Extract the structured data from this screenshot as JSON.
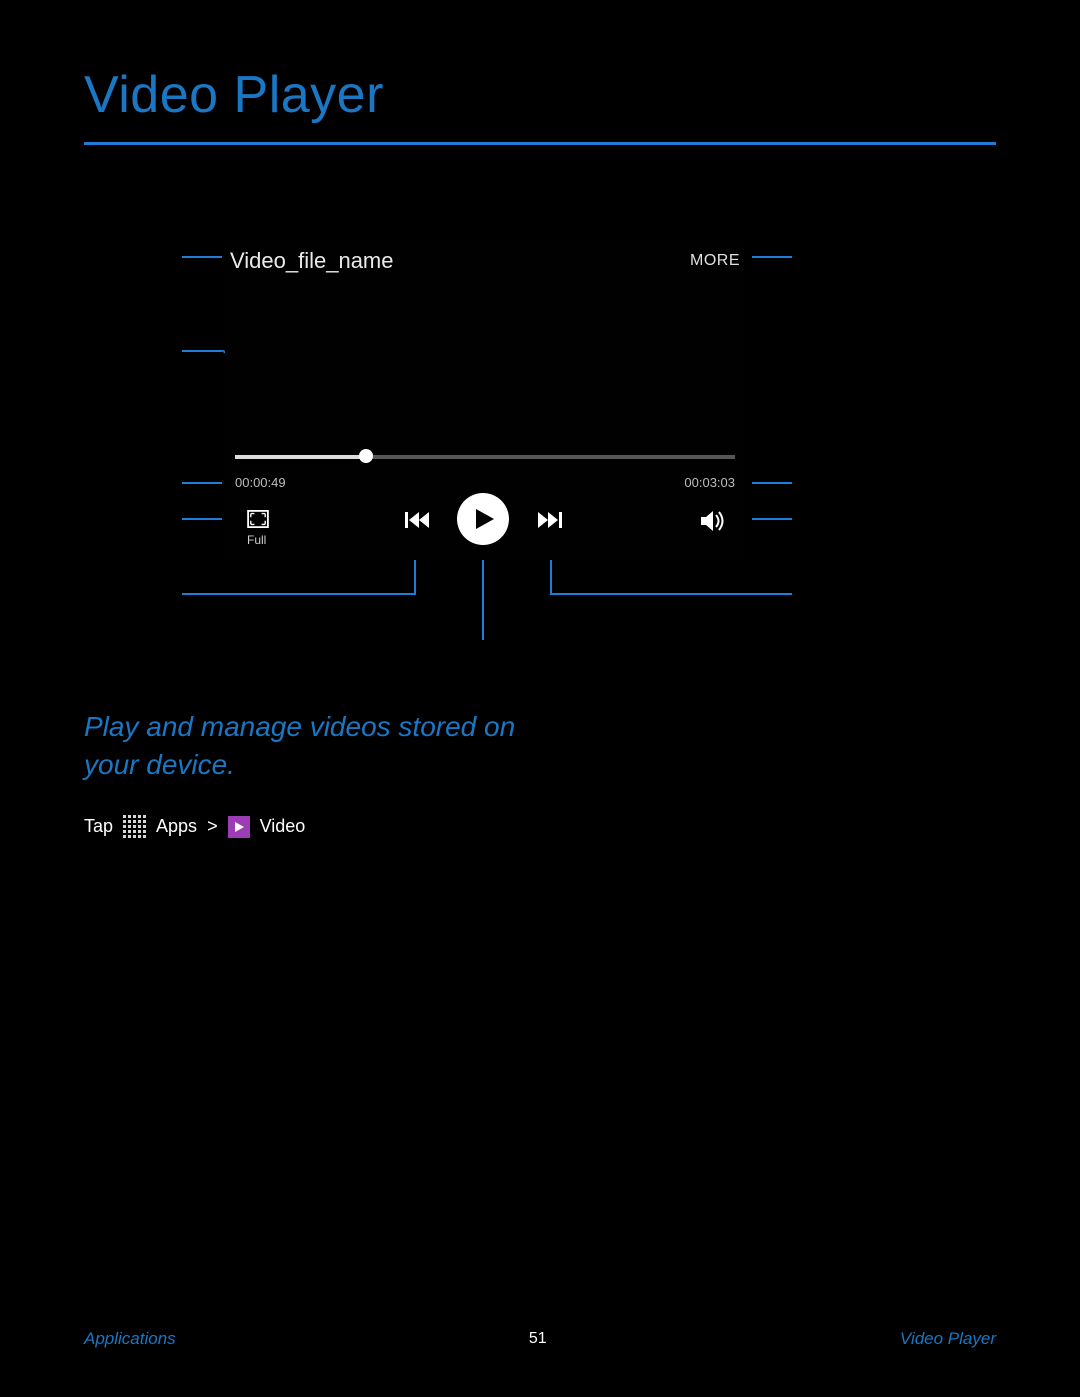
{
  "page": {
    "title": "Video Player",
    "description": "Play and manage videos stored on your device."
  },
  "player": {
    "file_name": "Video_file_name",
    "more_label": "MORE",
    "elapsed": "00:00:49",
    "total": "00:03:03",
    "full_label": "Full"
  },
  "instructions": {
    "prefix": "Tap ",
    "apps_label": "Apps",
    "sep": " > ",
    "video_label": "Video"
  },
  "footer": {
    "left": "Applications",
    "page": "51",
    "right": "Video Player"
  },
  "colors": {
    "accent": "#1c7ed6",
    "video_icon_bg": "#9c3db5"
  }
}
